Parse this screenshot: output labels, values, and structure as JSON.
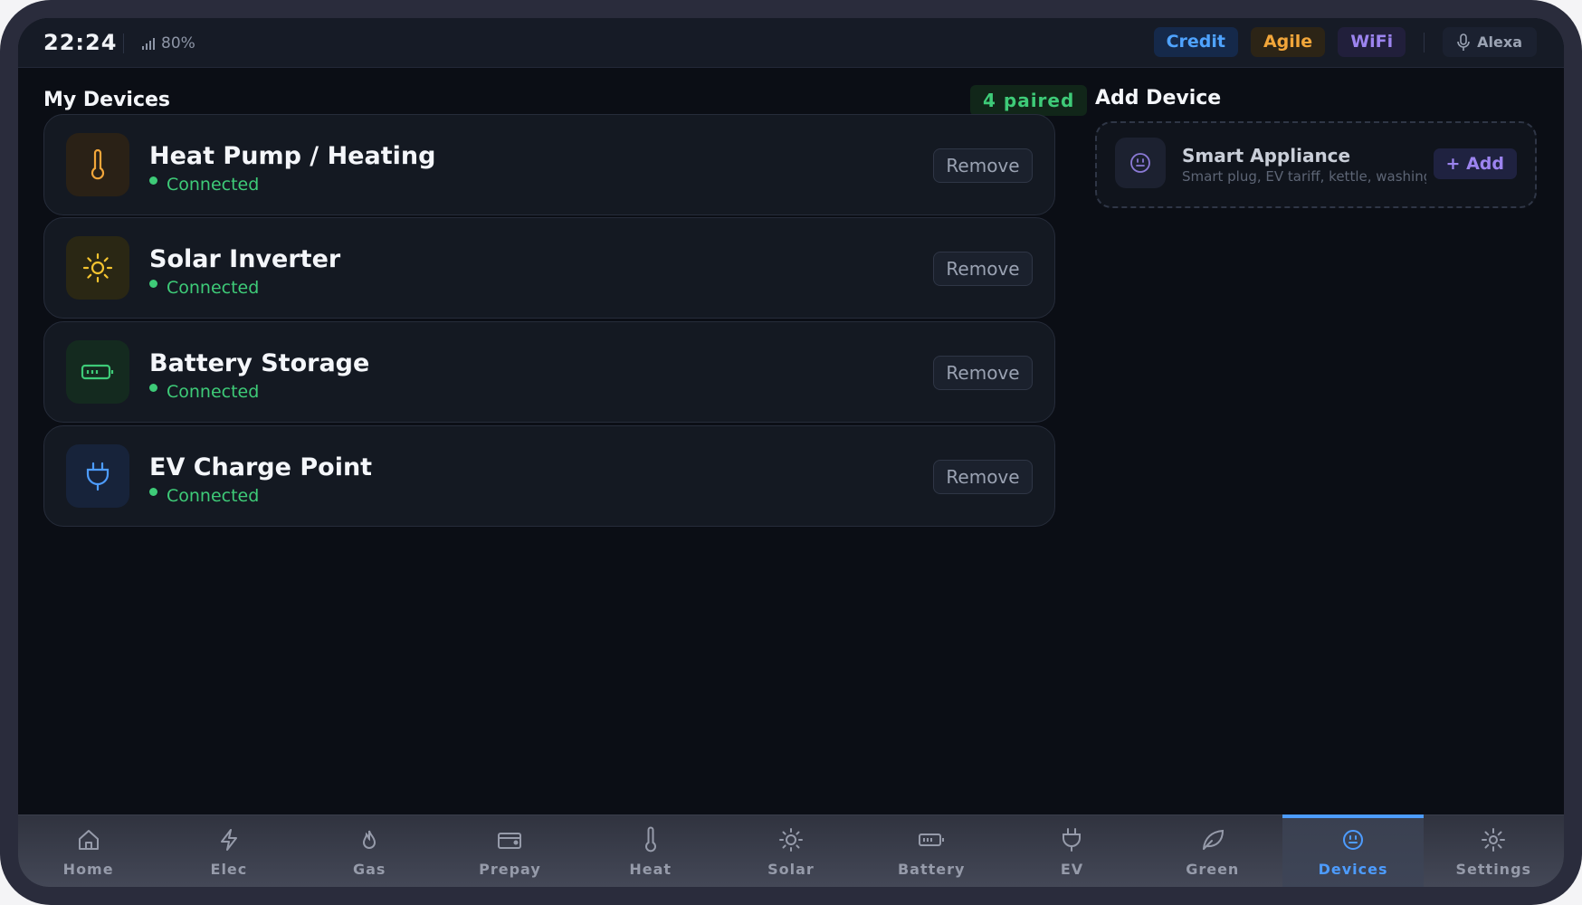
{
  "status": {
    "time": "22:24",
    "signal_text": "80%",
    "pills": [
      {
        "label": "Credit",
        "color": "#4fa3ff"
      },
      {
        "label": "Agile",
        "color": "#f2a63a"
      },
      {
        "label": "WiFi",
        "color": "#9c84ef"
      }
    ],
    "voice_label": "Alexa"
  },
  "devices": {
    "title": "My Devices",
    "paired_badge": "4 paired",
    "remove_label": "Remove",
    "items": [
      {
        "name": "Heat Pump / Heating",
        "status": "Connected",
        "icon": "thermometer-icon",
        "icon_color": "#f2a63a"
      },
      {
        "name": "Solar Inverter",
        "status": "Connected",
        "icon": "sun-icon",
        "icon_color": "#f4c430"
      },
      {
        "name": "Battery Storage",
        "status": "Connected",
        "icon": "battery-icon",
        "icon_color": "#3ecb78"
      },
      {
        "name": "EV Charge Point",
        "status": "Connected",
        "icon": "plug-icon",
        "icon_color": "#4d9cff"
      }
    ]
  },
  "add_device": {
    "title": "Add Device",
    "name": "Smart Appliance",
    "subtitle": "Smart plug, EV tariff, kettle, washing machine",
    "button_label": "+ Add",
    "icon": "smart-appliance-icon"
  },
  "nav": {
    "active": "Devices",
    "items": [
      {
        "label": "Home",
        "icon": "home-icon"
      },
      {
        "label": "Elec",
        "icon": "lightning-icon"
      },
      {
        "label": "Gas",
        "icon": "flame-icon"
      },
      {
        "label": "Prepay",
        "icon": "wallet-icon"
      },
      {
        "label": "Heat",
        "icon": "thermometer-icon"
      },
      {
        "label": "Solar",
        "icon": "sun-icon"
      },
      {
        "label": "Battery",
        "icon": "battery-icon"
      },
      {
        "label": "EV",
        "icon": "plug-icon"
      },
      {
        "label": "Green",
        "icon": "leaf-icon"
      },
      {
        "label": "Devices",
        "icon": "smart-appliance-icon"
      },
      {
        "label": "Settings",
        "icon": "gear-icon"
      }
    ]
  }
}
